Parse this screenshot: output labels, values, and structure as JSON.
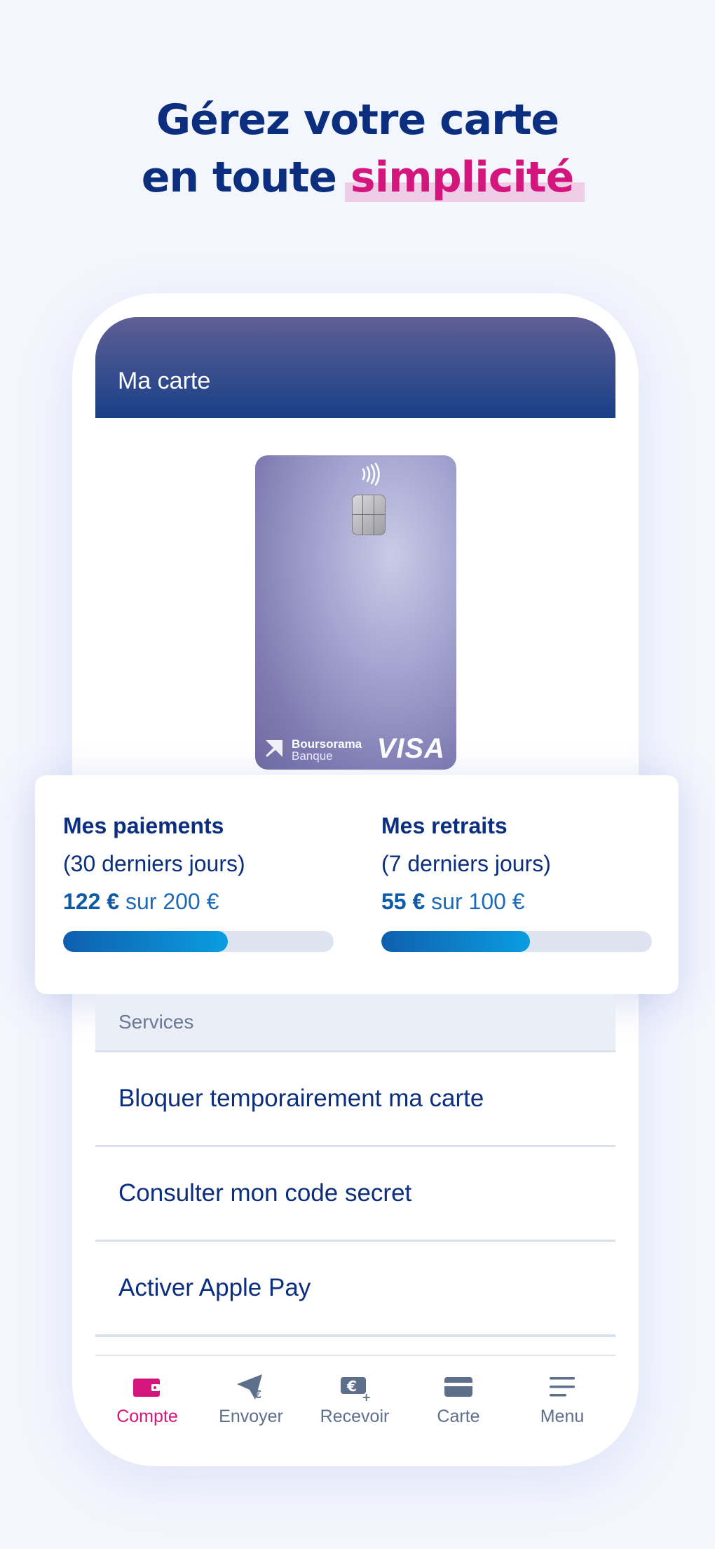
{
  "headline": {
    "line1": "Gérez votre carte",
    "line2_prefix": "en toute",
    "line2_highlight": "simplicité"
  },
  "screen": {
    "title": "Ma carte"
  },
  "card": {
    "brand_line1": "Boursorama",
    "brand_line2": "Banque",
    "network": "VISA"
  },
  "limits": {
    "payments": {
      "title": "Mes paiements",
      "period": "(30 derniers jours)",
      "amount": "122 €",
      "of_text": "sur 200 €",
      "progress": 0.61
    },
    "withdrawals": {
      "title": "Mes retraits",
      "period": "(7 derniers jours)",
      "amount": "55 €",
      "of_text": "sur 100 €",
      "progress": 0.55
    }
  },
  "services": {
    "section_label": "Services",
    "items": [
      {
        "label": "Bloquer temporairement ma carte"
      },
      {
        "label": "Consulter mon code secret"
      },
      {
        "label": "Activer Apple Pay"
      }
    ]
  },
  "tabbar": {
    "items": [
      {
        "label": "Compte",
        "icon": "wallet-icon",
        "active": true
      },
      {
        "label": "Envoyer",
        "icon": "send-euro-icon",
        "active": false
      },
      {
        "label": "Recevoir",
        "icon": "receive-euro-icon",
        "active": false
      },
      {
        "label": "Carte",
        "icon": "card-icon",
        "active": false
      },
      {
        "label": "Menu",
        "icon": "menu-icon",
        "active": false
      }
    ]
  },
  "colors": {
    "brand_navy": "#0b2e7e",
    "brand_pink": "#d4157e",
    "progress_blue": "#0a9de0"
  }
}
